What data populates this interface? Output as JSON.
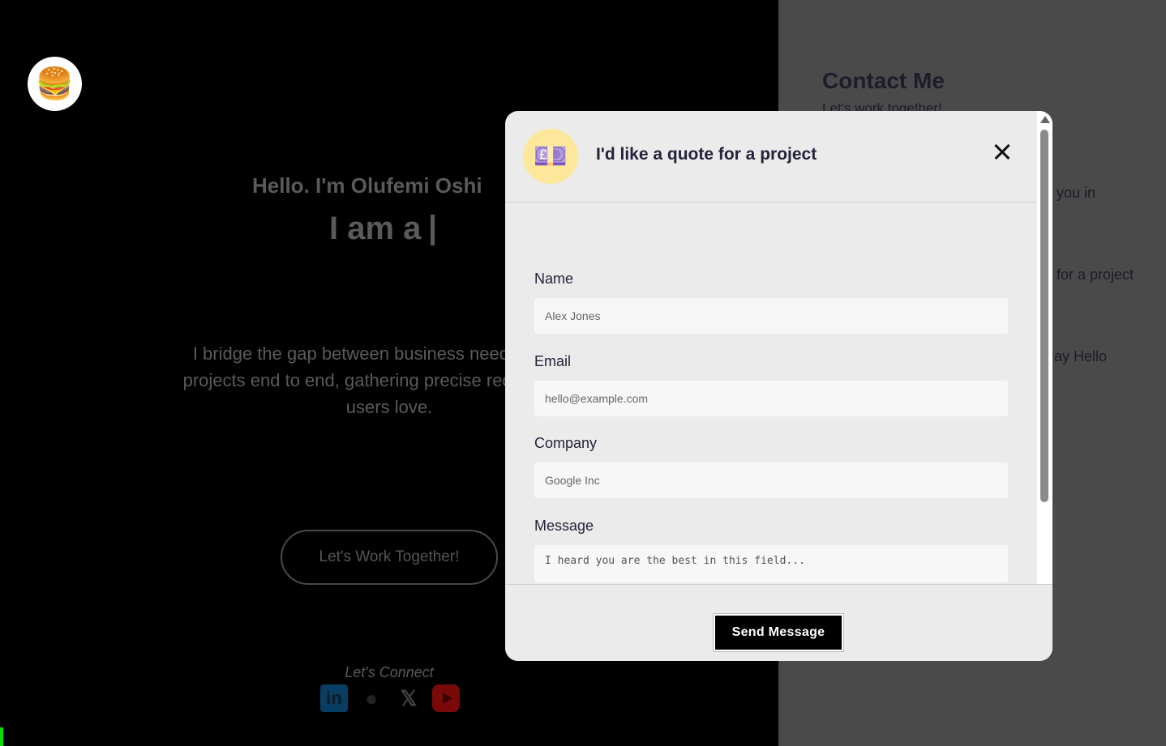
{
  "hero": {
    "logo_icon": "burger-icon",
    "hello": "Hello. I'm Olufemi Oshi",
    "iam": "I am a",
    "bio_lines": [
      "I bridge the gap between business needs and digi",
      "projects end to end, gathering precise requirements,",
      "users love."
    ],
    "cta": "Let's Work Together!",
    "connect": "Let's Connect",
    "socials": [
      "linkedin-icon",
      "github-icon",
      "x-icon",
      "youtube-icon"
    ]
  },
  "contact": {
    "title": "Contact Me",
    "subtitle": "Let's work together!",
    "items": [
      "you in",
      "for a project",
      "ay Hello"
    ]
  },
  "modal": {
    "icon": "money-icon",
    "title": "I'd like a quote for a project",
    "fields": {
      "name": {
        "label": "Name",
        "placeholder": "Alex Jones"
      },
      "email": {
        "label": "Email",
        "placeholder": "hello@example.com"
      },
      "company": {
        "label": "Company",
        "placeholder": "Google Inc"
      },
      "message": {
        "label": "Message",
        "placeholder": "I heard you are the best in this field..."
      }
    },
    "submit": "Send Message"
  },
  "colors": {
    "modal_bg": "#ebebeb",
    "accent_icon_bg": "#fde79a",
    "button_bg": "#000000",
    "right_panel": "#4a4a4a",
    "indicator": "#00e000"
  }
}
